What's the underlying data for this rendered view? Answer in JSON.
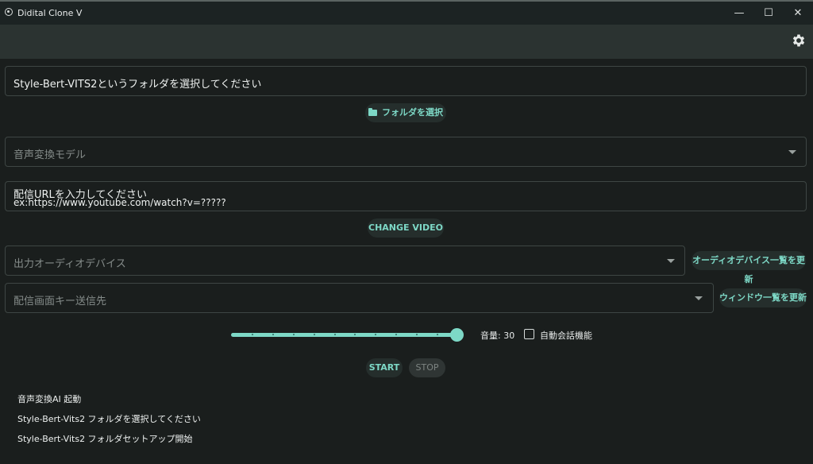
{
  "window": {
    "title": "Didital Clone V",
    "minimize": "—",
    "maximize": "☐",
    "close": "✕"
  },
  "folder": {
    "path_text": "Style-Bert-VITS2というフォルダを選択してください",
    "select_button": "フォルダを選択"
  },
  "model_select": {
    "placeholder": "音声変換モデル"
  },
  "url": {
    "label": "配信URLを入力してください",
    "placeholder": "ex:https://www.youtube.com/watch?v=?????",
    "change_button": "CHANGE VIDEO"
  },
  "audio_device": {
    "placeholder": "出力オーディオデバイス",
    "refresh_button": "オーディオデバイス一覧を更新"
  },
  "key_target": {
    "placeholder": "配信画面キー送信先",
    "refresh_button": "ウィンドウ一覧を更新"
  },
  "volume": {
    "label": "音量: 30",
    "value": 30,
    "max": 30
  },
  "auto_conversation": {
    "label": "自動会話機能",
    "checked": false
  },
  "controls": {
    "start": "START",
    "stop": "STOP"
  },
  "log": [
    "音声変換AI 起動",
    "Style-Bert-Vits2 フォルダを選択してください",
    "Style-Bert-Vits2 フォルダセットアップ開始"
  ],
  "colors": {
    "accent": "#7dd8c6",
    "background": "#1a1e1d",
    "appbar": "#2b3331"
  },
  "icons": {
    "settings": "gear-icon",
    "folder": "folder-icon",
    "dropdown": "chevron-down-icon"
  }
}
